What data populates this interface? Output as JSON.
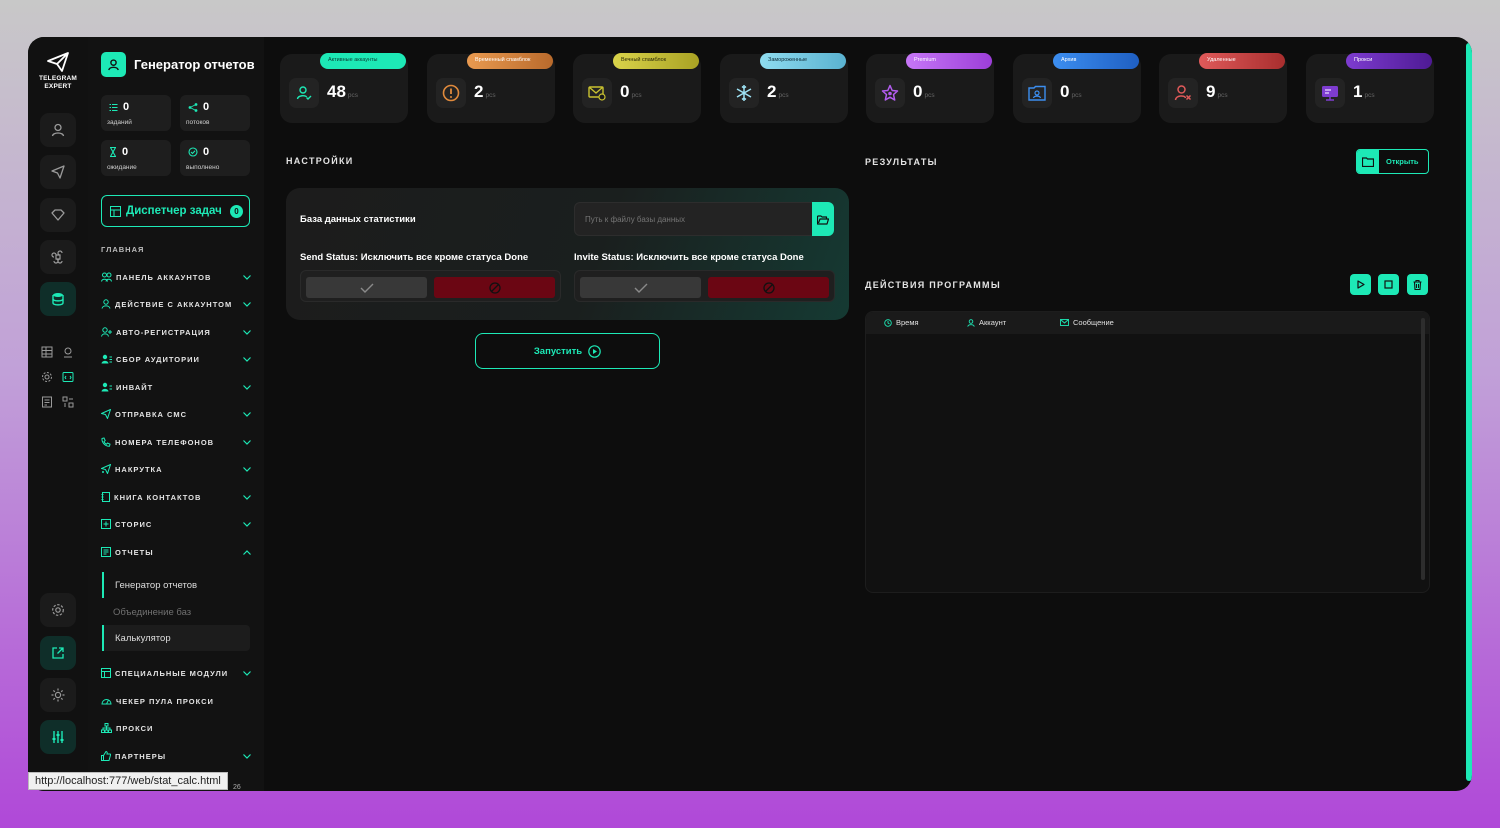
{
  "brand": {
    "line1": "TELEGRAM",
    "line2": "EXPERT"
  },
  "sidebar": {
    "title": "Генератор отчетов",
    "stats": [
      {
        "value": "0",
        "label": "заданий"
      },
      {
        "value": "0",
        "label": "потоков"
      },
      {
        "value": "0",
        "label": "ожидание"
      },
      {
        "value": "0",
        "label": "выполнено"
      }
    ],
    "dispatcher": {
      "label": "Диспетчер задач",
      "count": "0"
    },
    "section": "ГЛАВНАЯ",
    "nav": [
      "ПАНЕЛЬ АККАУНТОВ",
      "ДЕЙСТВИЕ С АККАУНТОМ",
      "АВТО-РЕГИСТРАЦИЯ",
      "СБОР АУДИТОРИИ",
      "ИНВАЙТ",
      "ОТПРАВКА СМС",
      "НОМЕРА ТЕЛЕФОНОВ",
      "НАКРУТКА",
      "КНИГА КОНТАКТОВ",
      "СТОРИС",
      "ОТЧЕТЫ"
    ],
    "sub": [
      "Генератор отчетов",
      "Объединение баз",
      "Калькулятор"
    ],
    "nav2": [
      "СПЕЦИАЛЬНЫЕ МОДУЛИ",
      "ЧЕКЕР ПУЛА ПРОКСИ",
      "ПРОКСИ",
      "ПАРТНЕРЫ"
    ]
  },
  "cards": [
    {
      "label": "Активные аккаунты",
      "value": "48",
      "unit": "pcs",
      "color": "#1de9b6",
      "icon": "user-check-icon"
    },
    {
      "label": "Временный спамблок",
      "value": "2",
      "unit": "pcs",
      "color": "#e08a3c",
      "icon": "alert-icon"
    },
    {
      "label": "Вечный спамблок",
      "value": "0",
      "unit": "pcs",
      "color": "#c9c230",
      "icon": "mail-block-icon"
    },
    {
      "label": "Замороженные",
      "value": "2",
      "unit": "pcs",
      "color": "#7fd3ea",
      "icon": "snowflake-icon"
    },
    {
      "label": "Premium",
      "value": "0",
      "unit": "pcs",
      "color": "#b45cf0",
      "icon": "star-icon"
    },
    {
      "label": "Архив",
      "value": "0",
      "unit": "pcs",
      "color": "#2f7de8",
      "icon": "archive-icon"
    },
    {
      "label": "Удаленные",
      "value": "9",
      "unit": "pcs",
      "color": "#d84a4a",
      "icon": "user-x-icon"
    },
    {
      "label": "Прокси",
      "value": "1",
      "unit": "pcs",
      "color": "#6a2bb8",
      "icon": "proxy-icon"
    }
  ],
  "settings": {
    "title": "НАСТРОЙКИ",
    "db_label": "База данных статистики",
    "db_placeholder": "Путь к файлу базы данных",
    "send_label": "Send Status: Исключить все кроме статуса Done",
    "invite_label": "Invite Status: Исключить все кроме статуса Done",
    "run": "Запустить"
  },
  "results": {
    "title": "РЕЗУЛЬТАТЫ",
    "open": "Открыть"
  },
  "actions": {
    "title": "ДЕЙСТВИЯ ПРОГРАММЫ",
    "columns": [
      "Время",
      "Аккаунт",
      "Сообщение"
    ]
  },
  "statusbar": {
    "url": "http://localhost:777/web/stat_calc.html",
    "num": "26"
  },
  "colors": {
    "accent": "#1de9b6",
    "deny": "#6b0613"
  }
}
